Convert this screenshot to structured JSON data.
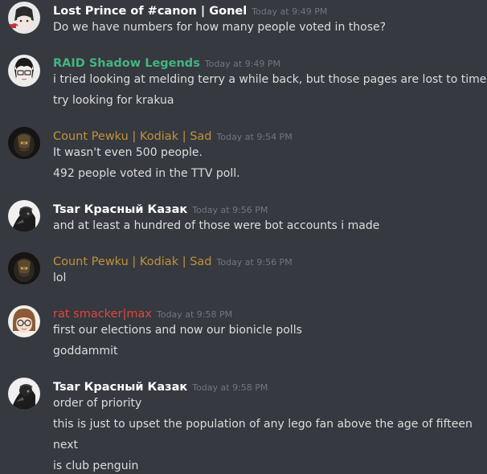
{
  "colors": {
    "background": "#36393f",
    "text": "#dcddde",
    "timestamp": "#72767d",
    "white_name": "#ffffff",
    "green_name": "#43b581",
    "gold_name": "#c1913c",
    "red_name": "#e1463e"
  },
  "messages": [
    {
      "username": "Lost Prince of #canon | Gonel",
      "timestamp": "Today at 9:49 PM",
      "lines": [
        "Do we have numbers for how many people voted in those?"
      ]
    },
    {
      "username": "RAID Shadow Legends",
      "timestamp": "Today at 9:49 PM",
      "lines": [
        "i tried looking at melding terry a while back, but those pages are lost to time",
        "try looking for krakua"
      ]
    },
    {
      "username": "Count Pewku | Kodiak | Sad",
      "timestamp": "Today at 9:54 PM",
      "lines": [
        "It wasn't even 500 people.",
        "492 people voted in the TTV poll."
      ]
    },
    {
      "username": "Tsar Красный Казак",
      "timestamp": "Today at 9:56 PM",
      "lines": [
        "and at least a hundred of those were bot accounts i made"
      ]
    },
    {
      "username": "Count Pewku | Kodiak | Sad",
      "timestamp": "Today at 9:56 PM",
      "lines": [
        "lol"
      ]
    },
    {
      "username": "rat smacker|max",
      "timestamp": "Today at 9:58 PM",
      "lines": [
        "first our elections and now our bionicle polls",
        "goddammit"
      ]
    },
    {
      "username": "Tsar Красный Казак",
      "timestamp": "Today at 9:58 PM",
      "lines": [
        "order of priority",
        "this is just to upset the population of any lego fan above the age of fifteen",
        "next",
        "is club penguin"
      ]
    }
  ]
}
